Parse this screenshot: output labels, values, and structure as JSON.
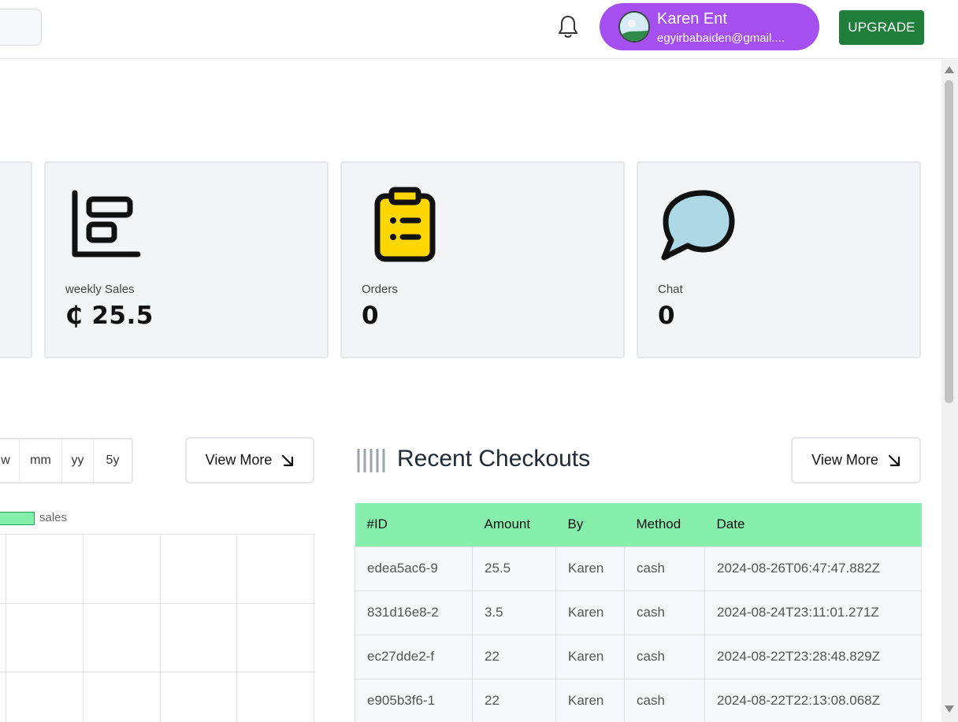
{
  "user": {
    "name": "Karen Ent",
    "email": "egyirbabaiden@gmail...."
  },
  "header": {
    "upgrade_label": "UPGRADE"
  },
  "stats": [
    {
      "label": "weekly Sales",
      "value": "₵ 25.5",
      "icon": "bar-chart-icon"
    },
    {
      "label": "Orders",
      "value": "0",
      "icon": "clipboard-list-icon"
    },
    {
      "label": "Chat",
      "value": "0",
      "icon": "chat-bubble-icon"
    }
  ],
  "chart_controls": {
    "periods": [
      "w",
      "mm",
      "yy",
      "5y"
    ],
    "view_more_label": "View More"
  },
  "chart_data": {
    "type": "bar",
    "series": [
      {
        "name": "sales",
        "values": []
      }
    ],
    "categories": [],
    "legend": "top",
    "grid": true
  },
  "checkouts": {
    "title": "Recent Checkouts",
    "view_more_label": "View More",
    "columns": [
      "#ID",
      "Amount",
      "By",
      "Method",
      "Date"
    ],
    "rows": [
      [
        "edea5ac6-9",
        "25.5",
        "Karen",
        "cash",
        "2024-08-26T06:47:47.882Z"
      ],
      [
        "831d16e8-2",
        "3.5",
        "Karen",
        "cash",
        "2024-08-24T23:11:01.271Z"
      ],
      [
        "ec27dde2-f",
        "22",
        "Karen",
        "cash",
        "2024-08-22T23:28:48.829Z"
      ],
      [
        "e905b3f6-1",
        "22",
        "Karen",
        "cash",
        "2024-08-22T22:13:08.068Z"
      ]
    ]
  },
  "colors": {
    "accent_purple": "#a64ff0",
    "upgrade_green": "#1e7e3a",
    "table_header": "#86efac",
    "orders_yellow": "#ffd700",
    "chat_blue": "#add8e6"
  }
}
